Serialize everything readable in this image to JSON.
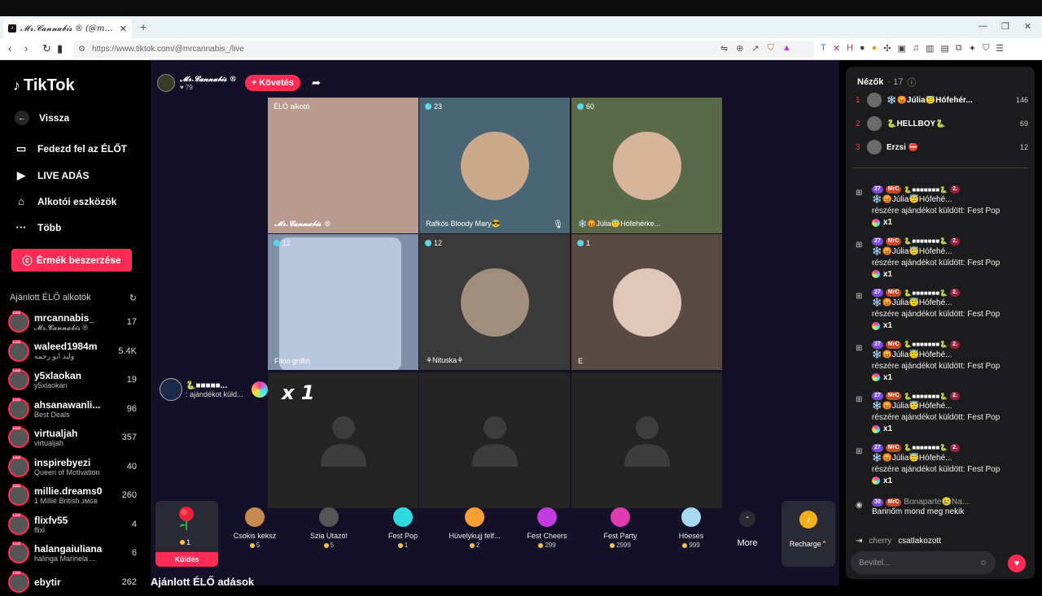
{
  "browser": {
    "tab_title": "𝓜𝓻.𝓒𝓪𝓷𝓷𝓪𝓫𝓲𝓼 ® (@mrcan",
    "url": "https://www.tiktok.com/@mrcannabis_/live"
  },
  "sidebar": {
    "logo": "TikTok",
    "nav": [
      {
        "label": "Vissza",
        "icon": "back-arrow-icon"
      },
      {
        "label": "Fedezd fel az ÉLŐT",
        "icon": "explore-icon"
      },
      {
        "label": "LIVE ADÁS",
        "icon": "live-icon"
      },
      {
        "label": "Alkotói eszközök",
        "icon": "creator-tools-icon"
      },
      {
        "label": "Több",
        "icon": "more-dots-icon"
      }
    ],
    "coins_button": "Érmék beszerzése",
    "recommended_title": "Ajánlott ÉLŐ alkotók",
    "creators": [
      {
        "name": "mrcannabis_",
        "sub": "𝓜𝓻.𝓒𝓪𝓷𝓷𝓪𝓫𝓲𝓼 ®",
        "count": "17"
      },
      {
        "name": "waleed1984m",
        "sub": "وليد ابو رحمه",
        "count": "5.4K"
      },
      {
        "name": "y5xlaokan",
        "sub": "y5xlaokan",
        "count": "19"
      },
      {
        "name": "ahsanawanli...",
        "sub": "Best Deals",
        "count": "96"
      },
      {
        "name": "virtualjah",
        "sub": "virtualjah",
        "count": "357"
      },
      {
        "name": "inspirebyezi",
        "sub": "Queen of Motivation",
        "count": "40"
      },
      {
        "name": "millie.dreams0",
        "sub": "1 Millie British ᴊᴍɢʙ",
        "count": "260"
      },
      {
        "name": "flixfv55",
        "sub": "flixl",
        "count": "4"
      },
      {
        "name": "halangaiuliana",
        "sub": "halinga Marinela ...",
        "count": "6"
      },
      {
        "name": "ebytir",
        "sub": "",
        "count": "262"
      }
    ]
  },
  "host": {
    "name": "𝓜𝓻.𝓒𝓪𝓷𝓷𝓪𝓫𝓲𝓼 ®",
    "likes": "79",
    "follow_label": "+ Követés"
  },
  "grid": {
    "cells": [
      {
        "label": "ÉLŐ alkotó",
        "name": "𝓜𝓻.𝓒𝓪𝓷𝓷𝓪𝓫𝓲𝓼 ®",
        "bg": "#b89a8f"
      },
      {
        "count": "23",
        "name": "Rafkós Bloody Mary😎",
        "bg": "#4a6675",
        "face": "#c9a98a"
      },
      {
        "count": "60",
        "name": "❄️😡Júlia😇Hófehérke...",
        "bg": "#5a6a48",
        "face": "#d7b59b"
      },
      {
        "count": "12",
        "name": "Filoo griffin",
        "bg": "#7f8fa8"
      },
      {
        "count": "12",
        "name": "⚘Nituska⚘",
        "bg": "#3a3a3a",
        "face": "#a08f7c"
      },
      {
        "count": "1",
        "name": "E",
        "bg": "#5a4a44",
        "face": "#e0c6b6"
      }
    ]
  },
  "gift_notification": {
    "user": "🐍■■■■■...",
    "text": ": ajándékot küld...",
    "multiplier": "x 1"
  },
  "gifts": {
    "selected": {
      "name": "Rose",
      "price": "1",
      "send_label": "Küldés"
    },
    "items": [
      {
        "name": "Csokis keksz",
        "price": "5",
        "color": "#c48a52"
      },
      {
        "name": "Szia Utazó!",
        "price": "5",
        "color": "#555"
      },
      {
        "name": "Fest Pop",
        "price": "1",
        "color": "#2fd9e0"
      },
      {
        "name": "Hüvelykujj felf...",
        "price": "2",
        "color": "#f5a030"
      },
      {
        "name": "Fest Cheers",
        "price": "299",
        "color": "#c03be0"
      },
      {
        "name": "Fest Party",
        "price": "2999",
        "color": "#e03bb0"
      },
      {
        "name": "Hóesés",
        "price": "999",
        "color": "#a8d8f0"
      }
    ],
    "more_label": "More",
    "recharge_label": "Recharge⌃"
  },
  "recommended_lives_title": "Ajánlott ÉLŐ adások",
  "chat": {
    "viewers_title": "Nézők",
    "viewers_count": "· 17",
    "top_viewers": [
      {
        "rank": "1",
        "name": "❄️😡Júlia😇Hófehér...",
        "score": "146"
      },
      {
        "rank": "2",
        "name": "🐍HELLBOY🐍",
        "score": "69"
      },
      {
        "rank": "3",
        "name": "Erzsi ⛔",
        "score": "12"
      }
    ],
    "gift_messages": [
      {
        "level": "27",
        "badge": "MrC",
        "user": "🐍■■■■■■■🐍",
        "rank": "2.",
        "name": "❄️😡Júlia😇Hófehé...",
        "text": "részére ajándékot küldött: Fest Pop",
        "count": "x1"
      },
      {
        "level": "27",
        "badge": "MrC",
        "user": "🐍■■■■■■■🐍",
        "rank": "2.",
        "name": "❄️😡Júlia😇Hófehé...",
        "text": "részére ajándékot küldött: Fest Pop",
        "count": "x1"
      },
      {
        "level": "27",
        "badge": "MrC",
        "user": "🐍■■■■■■■🐍",
        "rank": "2.",
        "name": "❄️😡Júlia😇Hófehé...",
        "text": "részére ajándékot küldött: Fest Pop",
        "count": "x1"
      },
      {
        "level": "27",
        "badge": "MrC",
        "user": "🐍■■■■■■■🐍",
        "rank": "2.",
        "name": "❄️😡Júlia😇Hófehé...",
        "text": "részére ajándékot küldött: Fest Pop",
        "count": "x1"
      },
      {
        "level": "27",
        "badge": "MrC",
        "user": "🐍■■■■■■■🐍",
        "rank": "2.",
        "name": "❄️😡Júlia😇Hófehé...",
        "text": "részére ajándékot küldött: Fest Pop",
        "count": "x1"
      },
      {
        "level": "27",
        "badge": "MrC",
        "user": "🐍■■■■■■■🐍",
        "rank": "2.",
        "name": "❄️😡Júlia😇Hófehé...",
        "text": "részére ajándékot küldött: Fest Pop",
        "count": "x1"
      }
    ],
    "comment": {
      "level": "30",
      "badge": "MrC",
      "user": "Bonaparte😢Na...",
      "text": "Barinőm mond meg nekik"
    },
    "joined": {
      "user": "cherry",
      "text": "csatlakozott"
    },
    "input_placeholder": "Bevitel..."
  }
}
